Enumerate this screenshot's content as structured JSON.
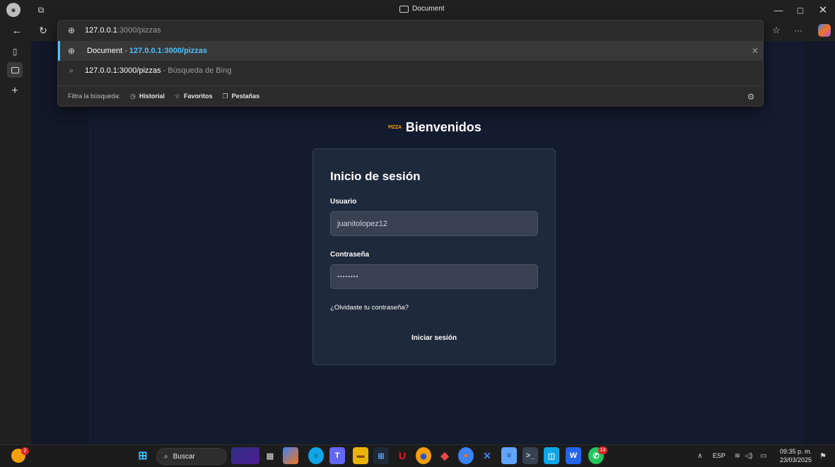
{
  "window": {
    "title": "Document"
  },
  "omnibox": {
    "host": "127.0.0.1",
    "path": ":3000/pizzas"
  },
  "suggestions": [
    {
      "title": "Document",
      "separator": " - ",
      "url": "127.0.0.1:3000/pizzas"
    },
    {
      "query": "127.0.0.1:3000/pizzas",
      "suffix": " - Búsqueda de Bing"
    }
  ],
  "filter": {
    "label": "Filtra la búsqueda:",
    "options": [
      {
        "label": "Historial",
        "icon": "history-icon"
      },
      {
        "label": "Favoritos",
        "icon": "star-icon"
      },
      {
        "label": "Pestañas",
        "icon": "tabs-icon"
      }
    ]
  },
  "page": {
    "brand_logo": "PIZZA",
    "brand_title": "Bienvenidos",
    "login": {
      "title": "Inicio de sesión",
      "user_label": "Usuario",
      "user_value": "juanitolopez12",
      "password_label": "Contraseña",
      "password_value": "••••••••",
      "forgot": "¿Olvidaste tu contraseña?",
      "submit": "Iniciar sesión"
    }
  },
  "taskbar": {
    "search": "Buscar",
    "language": "ESP",
    "time": "09:35 p. m.",
    "date": "23/03/2025",
    "notification_badge": "2",
    "whatsapp_badge": "14"
  },
  "colors": {
    "accent": "#4cc2ff",
    "card": "#1e293b",
    "page_bg": "#111827"
  }
}
